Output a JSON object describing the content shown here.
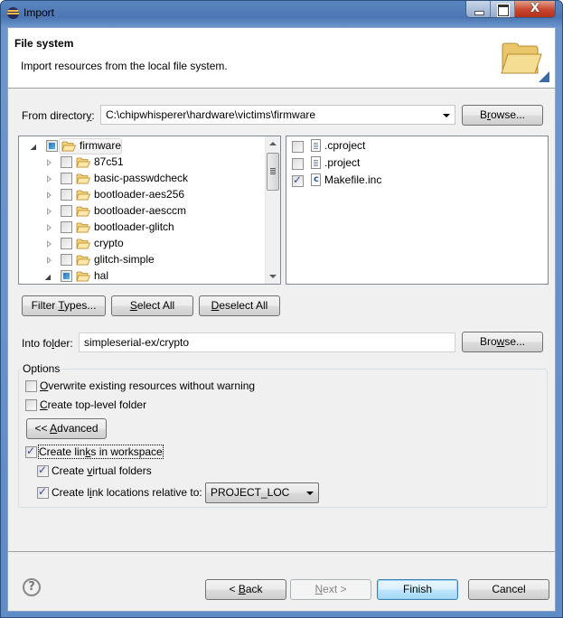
{
  "window": {
    "title": "Import",
    "icon": "eclipse-icon",
    "close_glyph": "X"
  },
  "header": {
    "title": "File system",
    "description": "Import resources from the local file system.",
    "icon": "folder-open-icon"
  },
  "from_directory": {
    "label_pre": "From director",
    "label_mnemonic": "y",
    "label_post": ":",
    "value": "C:\\chipwhisperer\\hardware\\victims\\firmware",
    "browse_pre": "B",
    "browse_mnemonic": "r",
    "browse_post": "owse..."
  },
  "folder_tree": {
    "items": [
      {
        "label": "firmware",
        "expanded": true,
        "check": "partial",
        "level": 0,
        "selected": true
      },
      {
        "label": "87c51",
        "expanded": false,
        "check": "unchecked",
        "level": 1
      },
      {
        "label": "basic-passwdcheck",
        "expanded": false,
        "check": "unchecked",
        "level": 1
      },
      {
        "label": "bootloader-aes256",
        "expanded": false,
        "check": "unchecked",
        "level": 1
      },
      {
        "label": "bootloader-aesccm",
        "expanded": false,
        "check": "unchecked",
        "level": 1
      },
      {
        "label": "bootloader-glitch",
        "expanded": false,
        "check": "unchecked",
        "level": 1
      },
      {
        "label": "crypto",
        "expanded": false,
        "check": "unchecked",
        "level": 1
      },
      {
        "label": "glitch-simple",
        "expanded": false,
        "check": "unchecked",
        "level": 1
      },
      {
        "label": "hal",
        "expanded": true,
        "check": "partial",
        "level": 1
      }
    ]
  },
  "file_list": {
    "items": [
      {
        "label": ".cproject",
        "checked": false,
        "icon": "text-file-icon"
      },
      {
        "label": ".project",
        "checked": false,
        "icon": "text-file-icon"
      },
      {
        "label": "Makefile.inc",
        "checked": true,
        "icon": "c-file-icon"
      }
    ]
  },
  "selection_buttons": {
    "filter_pre": "Filter ",
    "filter_mnemonic": "T",
    "filter_post": "ypes...",
    "select_mnemonic": "S",
    "select_post": "elect All",
    "deselect_mnemonic": "D",
    "deselect_post": "eselect All"
  },
  "into_folder": {
    "label_pre": "Into fo",
    "label_mnemonic": "l",
    "label_post": "der:",
    "value": "simpleserial-ex/crypto",
    "browse_pre": "Bro",
    "browse_mnemonic": "w",
    "browse_post": "se..."
  },
  "options": {
    "title": "Options",
    "overwrite": {
      "mnemonic": "O",
      "rest": "verwrite existing resources without warning",
      "checked": false
    },
    "top_level": {
      "mnemonic": "C",
      "rest": "reate top-level folder",
      "checked": false
    },
    "advanced_pre": "<< ",
    "advanced_mnemonic": "A",
    "advanced_post": "dvanced",
    "create_links": {
      "pre": "Create lin",
      "mnemonic": "k",
      "post": "s in workspace",
      "checked": true
    },
    "virtual_folders": {
      "pre": "Create ",
      "mnemonic": "v",
      "post": "irtual folders",
      "checked": true
    },
    "relative_to": {
      "pre": "Create l",
      "mnemonic": "i",
      "post": "nk locations relative to:",
      "checked": true,
      "value": "PROJECT_LOC"
    }
  },
  "footer": {
    "help_glyph": "?",
    "back_pre": "< ",
    "back_mnemonic": "B",
    "back_post": "ack",
    "next_mnemonic": "N",
    "next_post": "ext >",
    "finish": "Finish",
    "cancel": "Cancel"
  }
}
